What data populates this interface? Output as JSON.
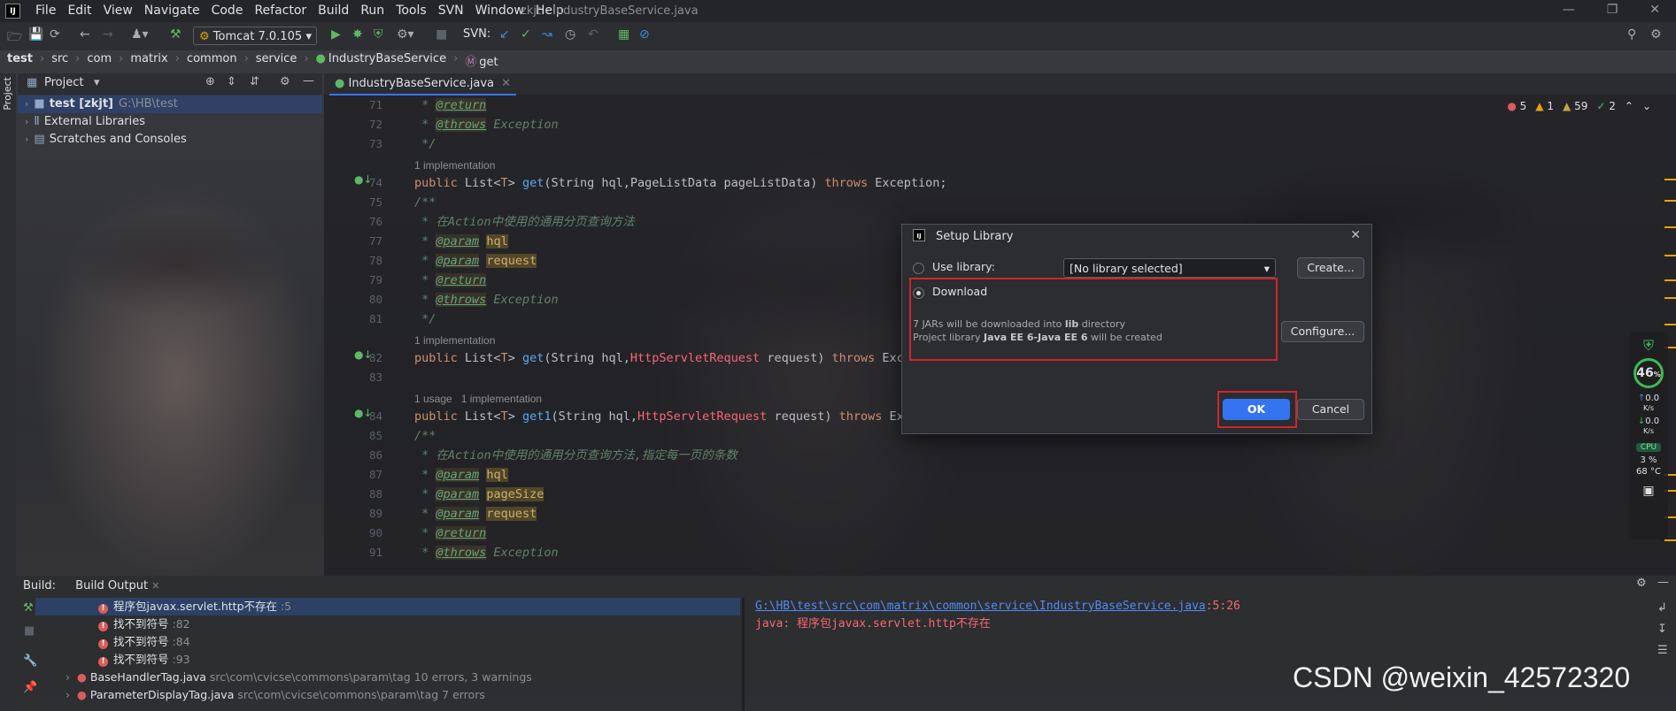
{
  "app": {
    "logo": "IJ",
    "window_title": "zkjt - IndustryBaseService.java",
    "menu": [
      "File",
      "Edit",
      "View",
      "Navigate",
      "Code",
      "Refactor",
      "Build",
      "Run",
      "Tools",
      "SVN",
      "Window",
      "Help"
    ]
  },
  "toolbar": {
    "run_config": "Tomcat 7.0.105",
    "svn_label": "SVN:"
  },
  "breadcrumb": [
    "test",
    "src",
    "com",
    "matrix",
    "common",
    "service",
    "IndustryBaseService",
    "get"
  ],
  "project": {
    "side_tab": "Project",
    "header": "Project",
    "items": [
      {
        "name": "test [zkjt]",
        "path": "G:\\HB\\test"
      },
      {
        "name": "External Libraries",
        "path": ""
      },
      {
        "name": "Scratches and Consoles",
        "path": ""
      }
    ]
  },
  "editor": {
    "tab": "IndustryBaseService.java",
    "inspections": {
      "errors": "5",
      "warnings": "1",
      "weak": "59",
      "ok": "2"
    },
    "lines": [
      {
        "n": "71",
        "kind": "doc",
        "parts": [
          [
            "doc",
            " * "
          ],
          [
            "tag",
            "@return"
          ]
        ]
      },
      {
        "n": "72",
        "kind": "doc",
        "parts": [
          [
            "doc",
            " * "
          ],
          [
            "tag",
            "@throws"
          ],
          [
            "doc",
            " Exception"
          ]
        ]
      },
      {
        "n": "73",
        "kind": "doc",
        "parts": [
          [
            "doc",
            " */"
          ]
        ]
      },
      {
        "n": "",
        "kind": "hint",
        "parts": [
          [
            "hint",
            "1 implementation"
          ]
        ]
      },
      {
        "n": "74",
        "kind": "code",
        "parts": [
          [
            "kw",
            "public "
          ],
          [
            "id",
            "List<"
          ],
          [
            "kw",
            "T"
          ],
          [
            "id",
            "> "
          ],
          [
            "fn",
            "get"
          ],
          [
            "id",
            "(String hql,PageListData pageListData) "
          ],
          [
            "kw",
            "throws "
          ],
          [
            "id",
            "Exception;"
          ]
        ]
      },
      {
        "n": "75",
        "kind": "doc",
        "parts": [
          [
            "doc",
            "/**"
          ]
        ]
      },
      {
        "n": "76",
        "kind": "doc",
        "parts": [
          [
            "doc",
            " * 在Action中使用的通用分页查询方法"
          ]
        ]
      },
      {
        "n": "77",
        "kind": "doc",
        "parts": [
          [
            "doc",
            " * "
          ],
          [
            "tag",
            "@param"
          ],
          [
            "doc",
            " "
          ],
          [
            "hl",
            "hql"
          ]
        ]
      },
      {
        "n": "78",
        "kind": "doc",
        "parts": [
          [
            "doc",
            " * "
          ],
          [
            "tag",
            "@param"
          ],
          [
            "doc",
            " "
          ],
          [
            "hl",
            "request"
          ]
        ]
      },
      {
        "n": "79",
        "kind": "doc",
        "parts": [
          [
            "doc",
            " * "
          ],
          [
            "tag",
            "@return"
          ]
        ]
      },
      {
        "n": "80",
        "kind": "doc",
        "parts": [
          [
            "doc",
            " * "
          ],
          [
            "tag",
            "@throws"
          ],
          [
            "doc",
            " Exception"
          ]
        ]
      },
      {
        "n": "81",
        "kind": "doc",
        "parts": [
          [
            "doc",
            " */"
          ]
        ]
      },
      {
        "n": "",
        "kind": "hint",
        "parts": [
          [
            "hint",
            "1 implementation"
          ]
        ]
      },
      {
        "n": "82",
        "kind": "code",
        "parts": [
          [
            "kw",
            "public "
          ],
          [
            "id",
            "List<"
          ],
          [
            "kw",
            "T"
          ],
          [
            "id",
            "> "
          ],
          [
            "fn",
            "get"
          ],
          [
            "id",
            "(String hql,"
          ],
          [
            "err",
            "HttpServletRequest"
          ],
          [
            "id",
            " request) "
          ],
          [
            "kw",
            "throws "
          ],
          [
            "id",
            "Exce"
          ]
        ]
      },
      {
        "n": "83",
        "kind": "code",
        "parts": [
          [
            "id",
            ""
          ]
        ]
      },
      {
        "n": "",
        "kind": "hint",
        "parts": [
          [
            "hint",
            "1 usage   1 implementation"
          ]
        ]
      },
      {
        "n": "84",
        "kind": "code",
        "parts": [
          [
            "kw",
            "public "
          ],
          [
            "id",
            "List<"
          ],
          [
            "kw",
            "T"
          ],
          [
            "id",
            "> "
          ],
          [
            "fn",
            "get1"
          ],
          [
            "id",
            "(String hql,"
          ],
          [
            "err",
            "HttpServletRequest"
          ],
          [
            "id",
            " request) "
          ],
          [
            "kw",
            "throws "
          ],
          [
            "id",
            "Exc"
          ]
        ]
      },
      {
        "n": "85",
        "kind": "doc",
        "parts": [
          [
            "doc",
            "/**"
          ]
        ]
      },
      {
        "n": "86",
        "kind": "doc",
        "parts": [
          [
            "doc",
            " * 在Action中使用的通用分页查询方法,指定每一页的条数"
          ]
        ]
      },
      {
        "n": "87",
        "kind": "doc",
        "parts": [
          [
            "doc",
            " * "
          ],
          [
            "tag",
            "@param"
          ],
          [
            "doc",
            " "
          ],
          [
            "hl",
            "hql"
          ]
        ]
      },
      {
        "n": "88",
        "kind": "doc",
        "parts": [
          [
            "doc",
            " * "
          ],
          [
            "tag",
            "@param"
          ],
          [
            "doc",
            " "
          ],
          [
            "hl",
            "pageSize"
          ]
        ]
      },
      {
        "n": "89",
        "kind": "doc",
        "parts": [
          [
            "doc",
            " * "
          ],
          [
            "tag",
            "@param"
          ],
          [
            "doc",
            " "
          ],
          [
            "hl",
            "request"
          ]
        ]
      },
      {
        "n": "90",
        "kind": "doc",
        "parts": [
          [
            "doc",
            " * "
          ],
          [
            "tag",
            "@return"
          ]
        ]
      },
      {
        "n": "91",
        "kind": "doc",
        "parts": [
          [
            "doc",
            " * "
          ],
          [
            "tag",
            "@throws"
          ],
          [
            "doc",
            " Exception"
          ]
        ]
      }
    ]
  },
  "dialog": {
    "title": "Setup Library",
    "use_library_label": "Use library:",
    "library_combo": "[No library selected]",
    "create_button": "Create...",
    "download_label": "Download",
    "info_line1_pre": "7 JARs will be downloaded into ",
    "info_line1_bold": "lib",
    "info_line1_post": " directory",
    "info_line2_pre": "Project library ",
    "info_line2_bold": "Java EE 6-Java EE 6",
    "info_line2_post": " will be created",
    "configure_button": "Configure...",
    "ok_button": "OK",
    "cancel_button": "Cancel"
  },
  "build": {
    "label": "Build:",
    "tab": "Build Output",
    "tree": [
      {
        "icon": "error",
        "text": "程序包javax.servlet.http不存在",
        "suffix": " :5",
        "selected": true
      },
      {
        "icon": "error",
        "text": "找不到符号",
        "suffix": " :82",
        "selected": false
      },
      {
        "icon": "error",
        "text": "找不到符号",
        "suffix": " :84",
        "selected": false
      },
      {
        "icon": "error",
        "text": "找不到符号",
        "suffix": " :93",
        "selected": false
      },
      {
        "icon": "file",
        "text": "BaseHandlerTag.java",
        "suffix": " src\\com\\cvicse\\commons\\param\\tag 10 errors, 3 warnings",
        "selected": false
      },
      {
        "icon": "file",
        "text": "ParameterDisplayTag.java",
        "suffix": " src\\com\\cvicse\\commons\\param\\tag 7 errors",
        "selected": false
      }
    ],
    "output_path": "G:\\HB\\test\\src\\com\\matrix\\common\\service\\IndustryBaseService.java",
    "output_pos": ":5:26",
    "output_msg": "java: 程序包javax.servlet.http不存在"
  },
  "widget": {
    "percent": "46",
    "percent_unit": "%",
    "up_speed": "0.0",
    "up_unit": "K/s",
    "down_speed": "0.0",
    "down_unit": "K/s",
    "cpu_label": "CPU",
    "cpu_usage": "3",
    "cpu_unit": "%",
    "cpu_temp": "68",
    "temp_unit": "°C"
  },
  "watermark": "CSDN @weixin_42572320",
  "colors": {
    "accent": "#3574f0",
    "highlight_box": "#d0262a",
    "error": "#db5c5c"
  }
}
